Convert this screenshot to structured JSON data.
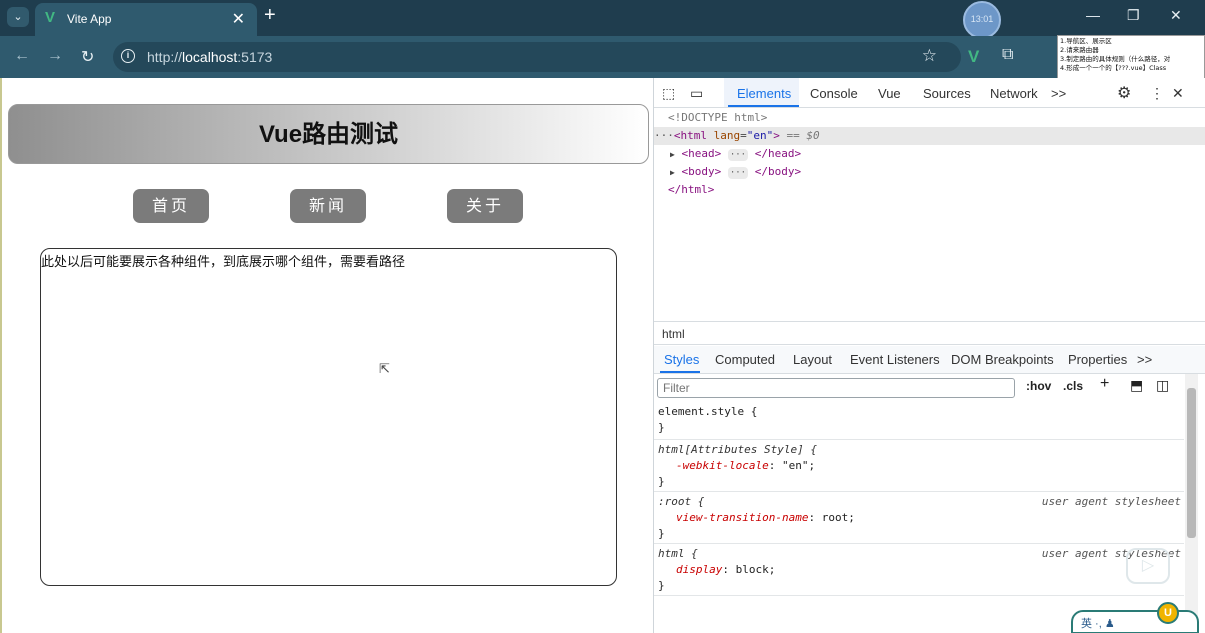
{
  "browser": {
    "tab": {
      "title": "Vite App",
      "favicon": "vue-logo-icon",
      "close": "✕"
    },
    "new_tab": "+",
    "profile_time": "13:01",
    "window_controls": {
      "minimize": "—",
      "restore": "❐",
      "close": "✕"
    },
    "url": {
      "scheme": "http://",
      "host": "localhost",
      "port": ":5173"
    },
    "note_overlay": [
      "1.导航区、展示区",
      "2.请来路由器",
      "3.制定路由的具体规则（什么路径，对",
      "4.形成一个一个的【???.vue】Class"
    ]
  },
  "page": {
    "title": "Vue路由测试",
    "nav": [
      {
        "label": "首页"
      },
      {
        "label": "新闻"
      },
      {
        "label": "关于"
      }
    ],
    "content_text": "此处以后可能要展示各种组件，到底展示哪个组件，需要看路径"
  },
  "devtools": {
    "tabs": [
      "Elements",
      "Console",
      "Vue",
      "Sources",
      "Network"
    ],
    "active_tab": "Elements",
    "more": ">>",
    "dom": {
      "doctype": "<!DOCTYPE html>",
      "html_open_tag": "<html",
      "lang_attr": "lang",
      "lang_value": "\"en\"",
      "html_close_bracket": ">",
      "eq_marker": "==",
      "dollar0": "$0",
      "head_open": "<head>",
      "head_close": "</head>",
      "body_open": "<body>",
      "body_close": "</body>",
      "html_close": "</html>",
      "ellipsis": "···",
      "gutter_dots": "···"
    },
    "breadcrumb": "html",
    "styles_tabs": [
      "Styles",
      "Computed",
      "Layout",
      "Event Listeners",
      "DOM Breakpoints",
      "Properties"
    ],
    "styles_more": ">>",
    "filter_placeholder": "Filter",
    "filter_tools": {
      "hov": ":hov",
      "cls": ".cls",
      "plus": "+"
    },
    "rules": {
      "r1_sel": "element.style {",
      "r2_sel": "html[Attributes Style] {",
      "r2_prop": "-webkit-locale",
      "r2_val": "\"en\";",
      "r3_sel": ":root {",
      "r3_origin": "user agent stylesheet",
      "r3_prop": "view-transition-name",
      "r3_val": "root;",
      "r4_sel": "html {",
      "r4_origin": "user agent stylesheet",
      "r4_prop": "display",
      "r4_val": "block;",
      "close": "}"
    }
  },
  "ime": {
    "text": "英 ·, ♟"
  }
}
